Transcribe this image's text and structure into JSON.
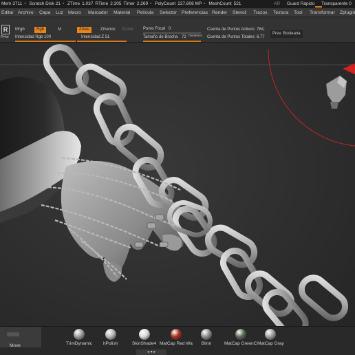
{
  "status_bar": {
    "mem": "Mem 3711",
    "scratch": "Scratch Disk 21",
    "ztime": "ZTime",
    "ztime_val": "1.037",
    "rtime": "RTime",
    "rtime_val": "2.305",
    "timer": "Timer",
    "timer_val": "2.269",
    "polycount": "PolyCount",
    "polycount_val": "227.608 MP",
    "meshcount": "MeshCount",
    "meshcount_val": "521",
    "ar": "AR",
    "quick_save": "Guard Rápido",
    "transparent": "Transparente 0",
    "dot": "•"
  },
  "menu": [
    "Editar",
    "Archivo",
    "Capa",
    "Luz",
    "Macro",
    "Marcador",
    "Material",
    "Película",
    "Selector",
    "Preferencias",
    "Render",
    "Stencil",
    "Trazos",
    "Textura",
    "Tool",
    "Transformar",
    "Zplugin"
  ],
  "toolbar": {
    "r_icon": "R",
    "r_label": "R=br",
    "mrgb": "Mrgb",
    "rgb": "Rgb",
    "m": "M",
    "rgb_intensity": "Intensidad Rgb 100",
    "zadd": "Zmás",
    "zsub": "Zmenos",
    "zcut": "Zcorte",
    "z_intensity": "Intensidad Z 51",
    "focal_point": "Punto Focal",
    "focal_value": "0",
    "brush_size": "Tamaño de Brocha",
    "brush_value": "72",
    "brush_suffix": "Dinámico",
    "active_points": "Cuenta de Puntos Activos: 764,",
    "total_points": "Cuenta de Puntos Totales: 6.77",
    "boolean_preview": "Prev. Booleana"
  },
  "bottom": {
    "move": "Move",
    "materials": [
      {
        "label": "TrimDynamic",
        "color": "#9a9a9a"
      },
      {
        "label": "hPolish",
        "color": "#b5b5b5"
      },
      {
        "label": "SkinShade4",
        "color": "#d9d9d9"
      },
      {
        "label": "MatCap Red Wa",
        "color": "#a8301f"
      },
      {
        "label": "Blinn",
        "color": "#8d8d8d"
      },
      {
        "label": "MatCap GreenC",
        "color": "#5a6a55"
      },
      {
        "label": "MatCap Gray",
        "color": "#9e9e9e"
      }
    ],
    "arrows": "◂ ▾ ▸"
  },
  "colors": {
    "accent": "#e8861c",
    "gizmo_red": "#d42020",
    "chain": "#c8c8c8",
    "background": "#2e2e2e"
  },
  "icons": [
    "move-icon",
    "head-gizmo-icon",
    "r-icon"
  ]
}
